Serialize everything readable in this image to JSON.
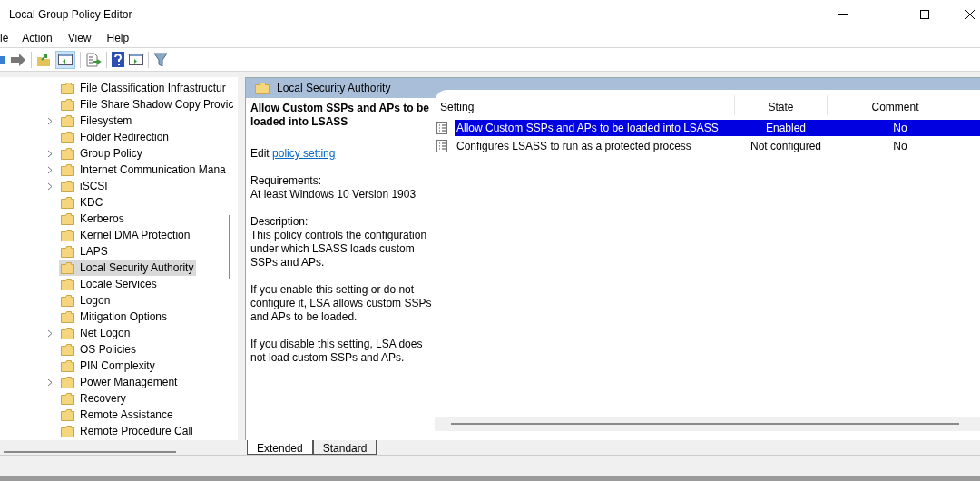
{
  "window": {
    "title": "Local Group Policy Editor"
  },
  "menu": [
    "le",
    "Action",
    "View",
    "Help"
  ],
  "tree": {
    "items": [
      {
        "label": "File Classification Infrastructur",
        "expandable": false,
        "selected": false
      },
      {
        "label": "File Share Shadow Copy Provic",
        "expandable": false,
        "selected": false
      },
      {
        "label": "Filesystem",
        "expandable": true,
        "selected": false
      },
      {
        "label": "Folder Redirection",
        "expandable": false,
        "selected": false
      },
      {
        "label": "Group Policy",
        "expandable": true,
        "selected": false
      },
      {
        "label": "Internet Communication Mana",
        "expandable": true,
        "selected": false
      },
      {
        "label": "iSCSI",
        "expandable": true,
        "selected": false
      },
      {
        "label": "KDC",
        "expandable": false,
        "selected": false
      },
      {
        "label": "Kerberos",
        "expandable": false,
        "selected": false
      },
      {
        "label": "Kernel DMA Protection",
        "expandable": false,
        "selected": false
      },
      {
        "label": "LAPS",
        "expandable": false,
        "selected": false
      },
      {
        "label": "Local Security Authority",
        "expandable": false,
        "selected": true
      },
      {
        "label": "Locale Services",
        "expandable": false,
        "selected": false
      },
      {
        "label": "Logon",
        "expandable": false,
        "selected": false
      },
      {
        "label": "Mitigation Options",
        "expandable": false,
        "selected": false
      },
      {
        "label": "Net Logon",
        "expandable": true,
        "selected": false
      },
      {
        "label": "OS Policies",
        "expandable": false,
        "selected": false
      },
      {
        "label": "PIN Complexity",
        "expandable": false,
        "selected": false
      },
      {
        "label": "Power Management",
        "expandable": true,
        "selected": false
      },
      {
        "label": "Recovery",
        "expandable": false,
        "selected": false
      },
      {
        "label": "Remote Assistance",
        "expandable": false,
        "selected": false
      },
      {
        "label": "Remote Procedure Call",
        "expandable": false,
        "selected": false
      }
    ]
  },
  "details": {
    "header": "Local Security Authority",
    "title": "Allow Custom SSPs and APs to be loaded into LSASS",
    "edit_label": "Edit",
    "edit_link": "policy setting",
    "requirements_label": "Requirements:",
    "requirements": "At least Windows 10 Version 1903",
    "description_label": "Description:",
    "paragraphs": [
      "This policy controls the configuration under which LSASS loads custom SSPs and APs.",
      "If you enable this setting or do not configure it, LSA allows custom SSPs and APs to be loaded.",
      "If you disable this setting, LSA does not load custom SSPs and APs."
    ]
  },
  "table": {
    "columns": [
      "Setting",
      "State",
      "Comment"
    ],
    "rows": [
      {
        "setting": "Allow Custom SSPs and APs to be loaded into LSASS",
        "state": "Enabled",
        "comment": "No",
        "selected": true
      },
      {
        "setting": "Configures LSASS to run as a protected process",
        "state": "Not configured",
        "comment": "No",
        "selected": false
      }
    ]
  },
  "tabs": [
    {
      "label": "Extended",
      "selected": true
    },
    {
      "label": "Standard",
      "selected": false
    }
  ]
}
